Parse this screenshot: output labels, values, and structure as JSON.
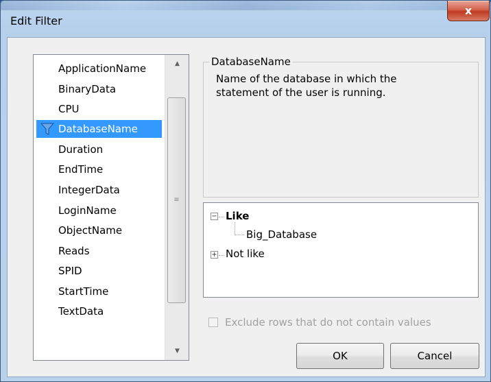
{
  "window": {
    "title": "Edit Filter",
    "close_label": "x"
  },
  "columns": {
    "items": [
      "ApplicationName",
      "BinaryData",
      "CPU",
      "DatabaseName",
      "Duration",
      "EndTime",
      "IntegerData",
      "LoginName",
      "ObjectName",
      "Reads",
      "SPID",
      "StartTime",
      "TextData"
    ],
    "selected_index": 3
  },
  "description": {
    "heading": "DatabaseName",
    "text": "Name of the database in which the statement of the user is running."
  },
  "tree": {
    "like_label": "Like",
    "like_value": "Big_Database",
    "not_like_label": "Not like"
  },
  "exclude_checkbox": {
    "label": "Exclude rows that do not contain values",
    "checked": false
  },
  "buttons": {
    "ok": "OK",
    "cancel": "Cancel"
  },
  "colors": {
    "selection": "#3399ff",
    "close_button": "#c03a22"
  }
}
